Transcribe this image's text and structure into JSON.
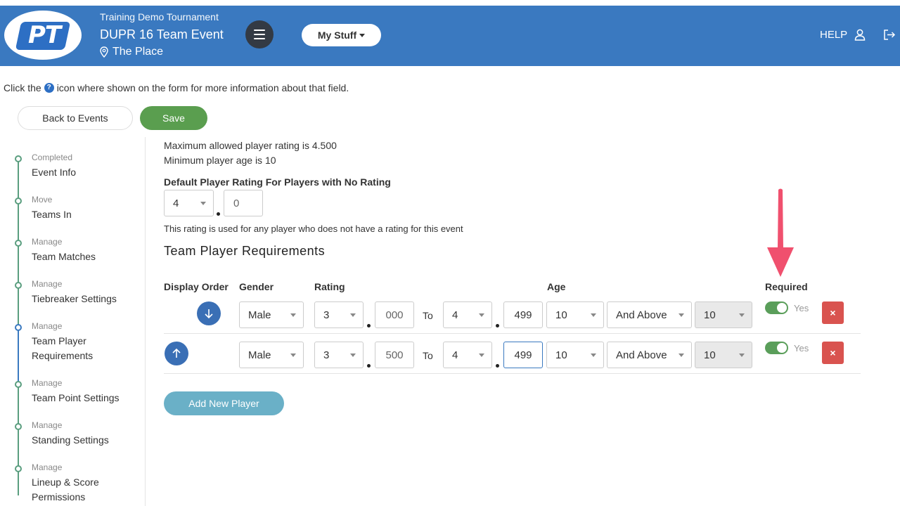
{
  "header": {
    "logo_text": "PT",
    "tournament": "Training Demo Tournament",
    "event": "DUPR 16 Team Event",
    "place": "The Place",
    "my_stuff": "My Stuff",
    "help": "HELP",
    "brand_color": "#3a79c0"
  },
  "info": {
    "prefix": "Click the",
    "suffix": "icon where shown on the form for more information about that field.",
    "icon": "question-circle-icon"
  },
  "actions": {
    "back": "Back to Events",
    "save": "Save",
    "save_color": "#5a9e4f"
  },
  "sidebar": {
    "steps": [
      {
        "label": "Completed",
        "title": "Event Info"
      },
      {
        "label": "Move",
        "title": "Teams In"
      },
      {
        "label": "Manage",
        "title": "Team Matches"
      },
      {
        "label": "Manage",
        "title": "Tiebreaker Settings"
      },
      {
        "label": "Manage",
        "title": "Team Player Requirements",
        "active": true
      },
      {
        "label": "Manage",
        "title": "Team Point Settings"
      },
      {
        "label": "Manage",
        "title": "Standing Settings"
      },
      {
        "label": "Manage",
        "title": "Lineup & Score Permissions"
      }
    ]
  },
  "main": {
    "max_rating": "Maximum allowed player rating is 4.500",
    "min_age": "Minimum player age is 10",
    "default_rating_label": "Default Player Rating For Players with No Rating",
    "default_rating_whole": "4",
    "default_rating_decimal": "0",
    "default_rating_note": "This rating is used for any player who does not have a rating for this event",
    "section_title": "Team Player Requirements",
    "columns": {
      "display_order": "Display Order",
      "gender": "Gender",
      "rating": "Rating",
      "age": "Age",
      "required": "Required"
    },
    "rows": [
      {
        "order_icon": "arrow-down-icon",
        "gender": "Male",
        "rating_from_whole": "3",
        "rating_from_decimal": "000",
        "to": "To",
        "rating_to_whole": "4",
        "rating_to_decimal": "499",
        "age_from": "10",
        "age_mode": "And Above",
        "age_to": "10",
        "required": "Yes"
      },
      {
        "order_icon": "arrow-up-icon",
        "gender": "Male",
        "rating_from_whole": "3",
        "rating_from_decimal": "500",
        "to": "To",
        "rating_to_whole": "4",
        "rating_to_decimal": "499",
        "age_from": "10",
        "age_mode": "And Above",
        "age_to": "10",
        "required": "Yes"
      }
    ],
    "add_button": "Add New Player",
    "delete_glyph": "×"
  }
}
